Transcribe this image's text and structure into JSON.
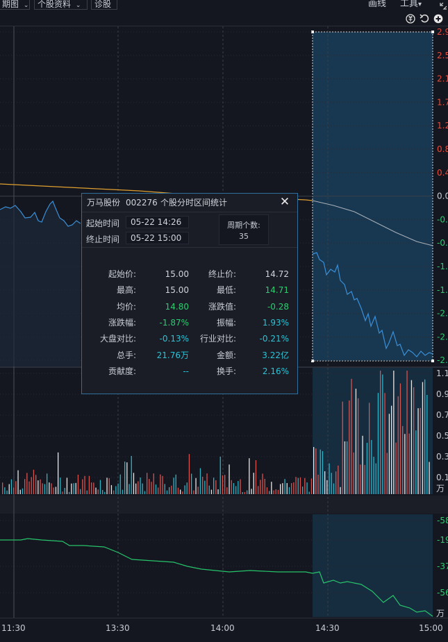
{
  "toolbar": {
    "items": [
      "期图",
      "个股资料",
      "诊股"
    ],
    "draw_line": "画线",
    "tools": "工具",
    "tools_arrow": "▾"
  },
  "icons": [
    "circle-dollar-icon",
    "undo-icon",
    "zoom-in-icon"
  ],
  "price_axis": {
    "labels": [
      "2.9",
      "2.5",
      "2.1",
      "1.7",
      "1.2",
      "0.8",
      "0.4",
      "0.0",
      "-0.",
      "-0.",
      "-1.",
      "-1.",
      "-2.",
      "-2.",
      "-2."
    ]
  },
  "volume_axis": {
    "labels": [
      "1.1",
      "0.9",
      "0.7",
      "0.5",
      "0.3",
      "0.1"
    ],
    "unit": "万"
  },
  "indicator_axis": {
    "labels": [
      "-58",
      "-19",
      "-37",
      "-56"
    ],
    "unit": "万"
  },
  "time_axis": {
    "labels": [
      "11:30",
      "13:30",
      "14:00",
      "14:30",
      "15:00"
    ]
  },
  "stats_panel": {
    "stock_name": "万马股份",
    "stock_code": "002276",
    "title": "个股分时区间统计",
    "start_time_label": "起始时间",
    "start_time": "05-22 14:26",
    "end_time_label": "终止时间",
    "end_time": "05-22 15:00",
    "period_count_label": "周期个数:",
    "period_count": "35",
    "rows": [
      {
        "l1": "起始价:",
        "v1": "15.00",
        "c1": "#d0d4da",
        "l2": "终止价:",
        "v2": "14.72",
        "c2": "#d0d4da"
      },
      {
        "l1": "最高:",
        "v1": "15.00",
        "c1": "#d0d4da",
        "l2": "最低:",
        "v2": "14.71",
        "c2": "#2ecc71"
      },
      {
        "l1": "均价:",
        "v1": "14.80",
        "c1": "#2ecc71",
        "l2": "涨跌值:",
        "v2": "-0.28",
        "c2": "#2ecc71"
      },
      {
        "l1": "涨跌幅:",
        "v1": "-1.87%",
        "c1": "#2ecc71",
        "l2": "振幅:",
        "v2": "1.93%",
        "c2": "#2bc4d6"
      },
      {
        "l1": "大盘对比:",
        "v1": "-0.13%",
        "c1": "#2bc4d6",
        "l2": "行业对比:",
        "v2": "-0.21%",
        "c2": "#2bc4d6"
      },
      {
        "l1": "总手:",
        "v1": "21.76万",
        "c1": "#2bc4d6",
        "l2": "金额:",
        "v2": "3.22亿",
        "c2": "#2bc4d6"
      },
      {
        "l1": "贡献度:",
        "v1": "--",
        "c1": "#2bc4d6",
        "l2": "换手:",
        "v2": "2.16%",
        "c2": "#2bc4d6"
      }
    ]
  },
  "colors": {
    "up": "#e74c3c",
    "down": "#2ecc71",
    "price_line": "#3b8fd6",
    "avg_line": "#e0a030",
    "volume_up": "#d9534f",
    "volume_down": "#2bb5c7",
    "volume_flat": "#e8e8e8",
    "indicator_line": "#27c46b",
    "selection": "#1b3a52"
  }
}
